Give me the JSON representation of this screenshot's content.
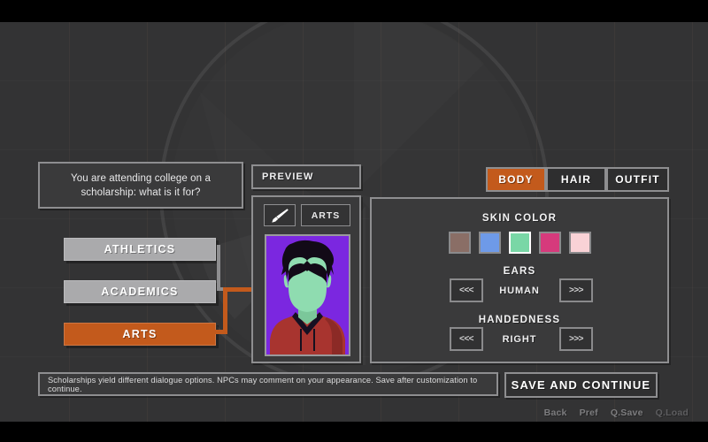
{
  "meta": {
    "background_color": "#333334",
    "accent_color": "#c35a1c",
    "panel_color": "#3a3a3b",
    "border_color": "#8e8e90"
  },
  "question": {
    "text": "You are attending college on a scholarship: what is it for?"
  },
  "choices": [
    {
      "label": "ATHLETICS",
      "state": "normal"
    },
    {
      "label": "ACADEMICS",
      "state": "normal"
    },
    {
      "label": "ARTS",
      "state": "selected"
    }
  ],
  "preview": {
    "title": "PREVIEW",
    "brush_icon": "paintbrush-icon",
    "tag_label": "ARTS",
    "portrait": {
      "background_color": "#7b27e0",
      "skin_color": "#8fdcb0",
      "hair_color": "#120a17",
      "clothing_color": "#a8342f",
      "clothing_shadow_color": "#8a2824",
      "collar_color": "#161022"
    }
  },
  "tabs": [
    {
      "label": "BODY",
      "active": true
    },
    {
      "label": "HAIR",
      "active": false
    },
    {
      "label": "OUTFIT",
      "active": false
    }
  ],
  "options": {
    "skin_color": {
      "label": "SKIN COLOR",
      "swatches": [
        {
          "color": "#8a6e66",
          "selected": false
        },
        {
          "color": "#6e9ae8",
          "selected": false
        },
        {
          "color": "#79d7a6",
          "selected": true
        },
        {
          "color": "#d63a7c",
          "selected": false
        },
        {
          "color": "#f9d2d6",
          "selected": false
        }
      ]
    },
    "ears": {
      "label": "EARS",
      "value": "HUMAN",
      "prev_label": "<<<",
      "next_label": ">>>"
    },
    "handedness": {
      "label": "HANDEDNESS",
      "value": "RIGHT",
      "prev_label": "<<<",
      "next_label": ">>>"
    }
  },
  "status": {
    "text": "Scholarships yield different dialogue options. NPCs may comment on your appearance. Save after customization to continue."
  },
  "save_button": {
    "label": "SAVE AND CONTINUE"
  },
  "quick_menu": [
    {
      "label": "Back",
      "dim": false
    },
    {
      "label": "Pref",
      "dim": false
    },
    {
      "label": "Q.Save",
      "dim": false
    },
    {
      "label": "Q.Load",
      "dim": true
    }
  ]
}
